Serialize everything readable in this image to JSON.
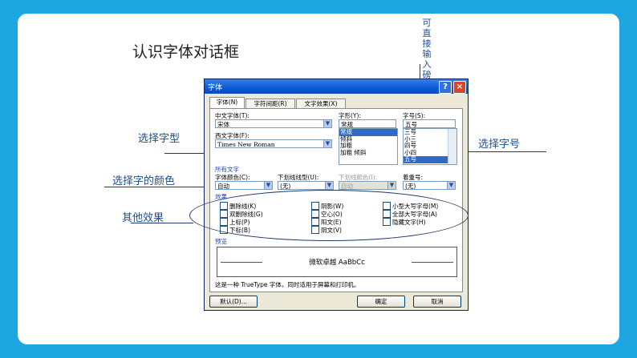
{
  "slide": {
    "title": "认识字体对话框",
    "callouts": {
      "select_style": "选择字型",
      "select_color": "选择字的颜色",
      "other_effects": "其他效果",
      "select_size": "选择字号",
      "direct_input": "可直接输入磅值"
    }
  },
  "dialog": {
    "title": "字体",
    "help_label": "?",
    "close_label": "×",
    "tabs": [
      "字体(N)",
      "字符间距(R)",
      "文字效果(X)"
    ],
    "chinese_font_label": "中文字体(T):",
    "chinese_font_value": "宋体",
    "western_font_label": "西文字体(F):",
    "western_font_value": "Times New Roman",
    "style_label": "字形(Y):",
    "style_value": "常规",
    "style_options": [
      "常规",
      "倾斜",
      "加粗",
      "加粗 倾斜"
    ],
    "size_label": "字号(S):",
    "size_value": "五号",
    "size_options": [
      "三号",
      "小三",
      "四号",
      "小四",
      "五号"
    ],
    "all_text_label": "所有文字",
    "font_color_label": "字体颜色(C):",
    "font_color_value": "自动",
    "underline_label": "下划线线型(U):",
    "underline_value": "(无)",
    "underline_color_label": "下划线颜色(I):",
    "underline_color_value": "自动",
    "emphasis_label": "着重号:",
    "emphasis_value": "(无)",
    "effects_label": "效果",
    "effects": [
      [
        "删除线(K)",
        "双删除线(G)",
        "上标(P)",
        "下标(B)"
      ],
      [
        "阴影(W)",
        "空心(O)",
        "阳文(E)",
        "阴文(V)"
      ],
      [
        "小型大写字母(M)",
        "全部大写字母(A)",
        "隐藏文字(H)"
      ]
    ],
    "preview_label": "预览",
    "preview_text": "微软卓越 AaBbCc",
    "info_text": "这是一种 TrueType 字体，同时适用于屏幕和打印机。",
    "default_button": "默认(D)...",
    "ok_button": "确定",
    "cancel_button": "取消"
  }
}
